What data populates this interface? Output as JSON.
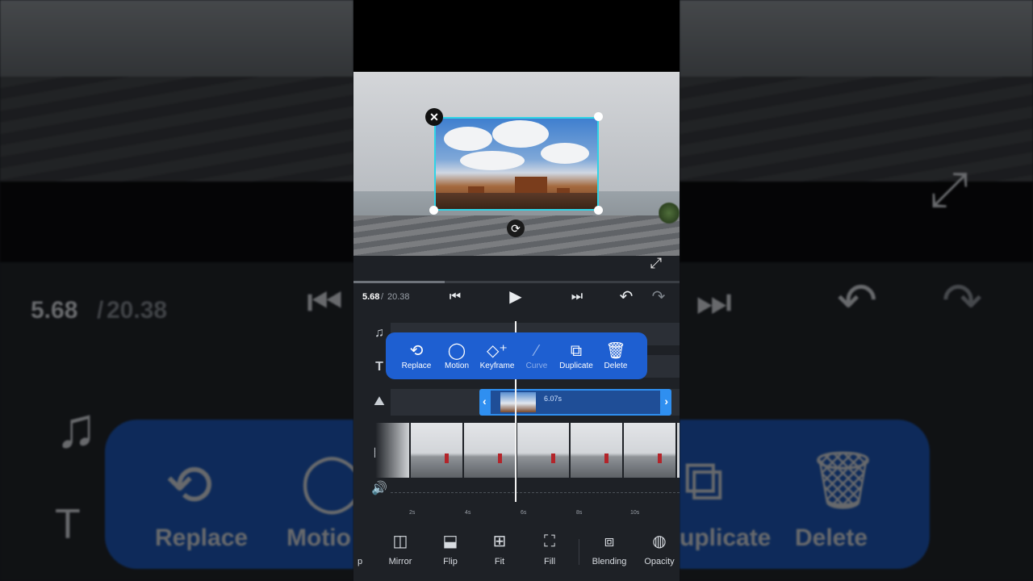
{
  "playback": {
    "current_time": "5.68",
    "separator": " / ",
    "total_time": "20.38",
    "progress_fraction": 0.279
  },
  "context_menu": {
    "items": [
      {
        "label": "Replace",
        "icon": "replace-icon",
        "glyph": "⟲"
      },
      {
        "label": "Motion",
        "icon": "motion-icon",
        "glyph": "◯"
      },
      {
        "label": "Keyframe",
        "icon": "keyframe-icon",
        "glyph": "◇⁺"
      },
      {
        "label": "Curve",
        "icon": "curve-icon",
        "glyph": "⁄",
        "disabled": true
      },
      {
        "label": "Duplicate",
        "icon": "duplicate-icon",
        "glyph": "⧉"
      },
      {
        "label": "Delete",
        "icon": "trash-icon",
        "glyph": "🗑"
      }
    ]
  },
  "overlay_clip": {
    "duration": "6.07s"
  },
  "ruler": {
    "ticks": [
      "2s",
      "4s",
      "6s",
      "8s",
      "10s"
    ]
  },
  "toolbar": {
    "items": [
      {
        "label": "p",
        "icon": "crop-icon",
        "glyph": "⌗"
      },
      {
        "label": "Mirror",
        "icon": "mirror-icon",
        "glyph": "◫"
      },
      {
        "label": "Flip",
        "icon": "flip-icon",
        "glyph": "⬓"
      },
      {
        "label": "Fit",
        "icon": "fit-icon",
        "glyph": "⊞"
      },
      {
        "label": "Fill",
        "icon": "fill-icon",
        "glyph": "⛶"
      },
      {
        "label": "Blending",
        "icon": "blending-icon",
        "glyph": "⧈"
      },
      {
        "label": "Opacity",
        "icon": "opacity-icon",
        "glyph": "◍"
      }
    ]
  },
  "background": {
    "left_time_current": "5.68",
    "left_time_total": "20.38",
    "left_menu_labels": [
      "Replace",
      "Motio"
    ],
    "right_menu_labels": [
      "uplicate",
      "Delete"
    ]
  },
  "colors": {
    "accent_blue": "#1e5fd1",
    "selection_cyan": "#2fd3e6",
    "panel": "#1e2126"
  }
}
